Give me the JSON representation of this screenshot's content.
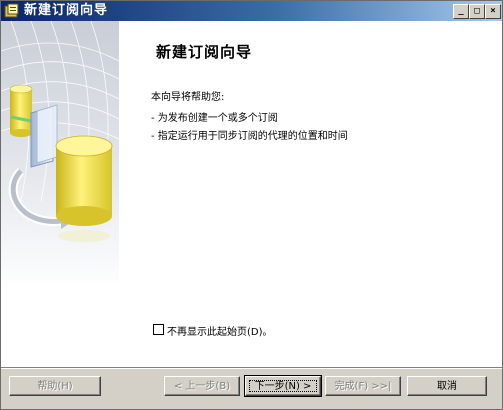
{
  "window": {
    "title": "新建订阅向导",
    "controls": {
      "minimize": "_",
      "maximize": "□",
      "close": "×"
    }
  },
  "page": {
    "heading": "新建订阅向导",
    "intro": "本向导将帮助您:",
    "bullets": [
      "- 为发布创建一个或多个订阅",
      "- 指定运行用于同步订阅的代理的位置和时间"
    ],
    "checkbox": {
      "label": "不再显示此起始页(D)。",
      "checked": false
    }
  },
  "buttons": {
    "help": "帮助(H)",
    "back": "< 上一步(B)",
    "next": "下一步(N) >",
    "finish": "完成(F) >>|",
    "cancel": "取消"
  },
  "icons": {
    "title": "wizard-app-icon",
    "art": "database-sync-illustration"
  },
  "colors": {
    "titlebar_start": "#0a246a",
    "titlebar_end": "#a6caf0",
    "face": "#d4d0c8",
    "cylinder": "#f2e33a"
  }
}
